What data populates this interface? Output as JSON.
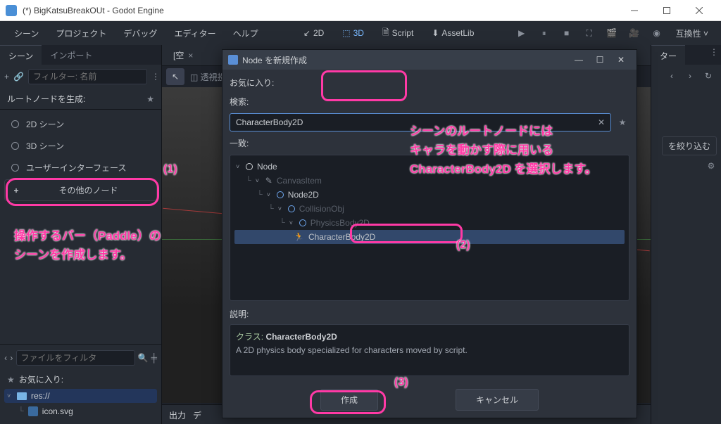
{
  "window_title": "(*) BigKatsuBreakOUt - Godot Engine",
  "menubar": {
    "items": [
      "シーン",
      "プロジェクト",
      "デバッグ",
      "エディター",
      "ヘルプ"
    ],
    "workspaces": [
      {
        "label": "2D",
        "icon": "↙"
      },
      {
        "label": "3D",
        "icon": "⬚"
      },
      {
        "label": "Script",
        "icon": "🗎"
      },
      {
        "label": "AssetLib",
        "icon": "⬇"
      }
    ],
    "compat": "互換性 ˅"
  },
  "left": {
    "tabs": [
      "シーン",
      "インポート"
    ],
    "filter_placeholder": "フィルター: 名前",
    "root_label": "ルートノードを生成:",
    "opts": [
      "2D シーン",
      "3D シーン",
      "ユーザーインターフェース",
      "その他のノード"
    ],
    "file_filter_placeholder": "ファイルをフィルタ",
    "favorites": "お気に入り:",
    "res": "res://",
    "icon_file": "icon.svg"
  },
  "center": {
    "tab_label": "[空",
    "transparent": "透視投",
    "bottom": [
      "出力",
      "デ"
    ]
  },
  "right": {
    "tab": "ター",
    "load": "を絞り込む"
  },
  "dialog": {
    "title": "Node を新規作成",
    "fav_label": "お気に入り:",
    "search_label": "検索:",
    "search_value": "CharacterBody2D",
    "match_label": "一致:",
    "tree": {
      "node": "Node",
      "canvas": "CanvasItem",
      "node2d": "Node2D",
      "collision": "CollisionObj",
      "physics": "PhysicsBody2D",
      "character": "CharacterBody2D"
    },
    "desc_label": "説明:",
    "class_prefix": "クラス: ",
    "class_name": "CharacterBody2D",
    "desc_text": "A 2D physics body specialized for characters moved by script.",
    "create": "作成",
    "cancel": "キャンセル"
  },
  "annotations": {
    "n1": "(1)",
    "n2": "(2)",
    "n3": "(3)",
    "paddle_text": "操作するバー（Paddle）の\nシーンを作成します。",
    "root_text": "シーンのルートノードには\nキャラを動かす際に用いる\nCharacterBody2D を選択します。"
  }
}
